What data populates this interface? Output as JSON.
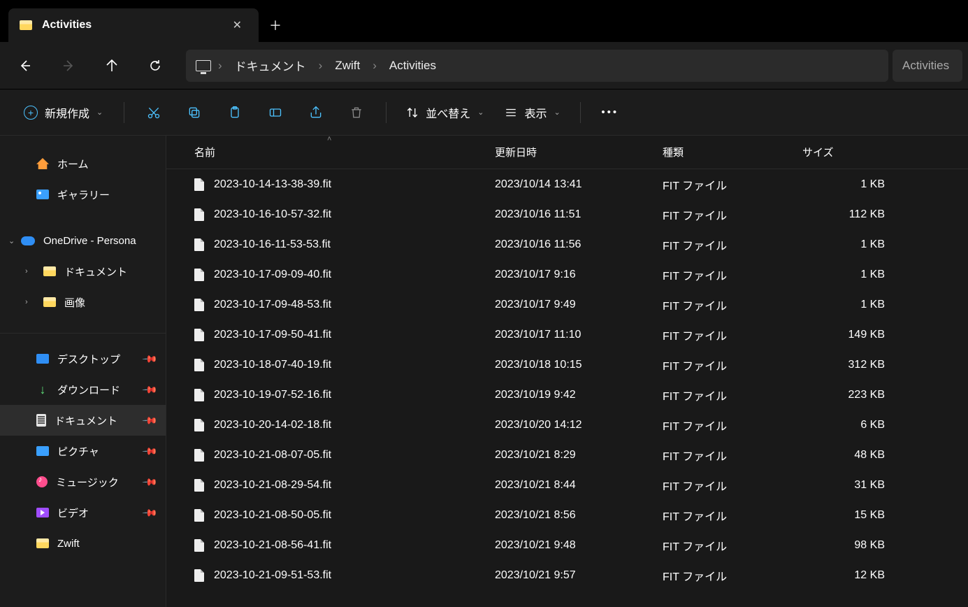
{
  "tab": {
    "title": "Activities"
  },
  "breadcrumb": {
    "items": [
      "ドキュメント",
      "Zwift",
      "Activities"
    ]
  },
  "search": {
    "placeholder": "Activities"
  },
  "toolbar": {
    "new_label": "新規作成",
    "sort_label": "並べ替え",
    "view_label": "表示"
  },
  "sidebar": {
    "home": "ホーム",
    "gallery": "ギャラリー",
    "onedrive": "OneDrive - Persona",
    "documents": "ドキュメント",
    "pictures": "画像",
    "quick": {
      "desktop": "デスクトップ",
      "downloads": "ダウンロード",
      "documents": "ドキュメント",
      "pictures_q": "ピクチャ",
      "music": "ミュージック",
      "video": "ビデオ",
      "zwift": "Zwift"
    }
  },
  "columns": {
    "name": "名前",
    "date": "更新日時",
    "type": "種類",
    "size": "サイズ"
  },
  "files": [
    {
      "name": "2023-10-14-13-38-39.fit",
      "date": "2023/10/14 13:41",
      "type": "FIT ファイル",
      "size": "1 KB"
    },
    {
      "name": "2023-10-16-10-57-32.fit",
      "date": "2023/10/16 11:51",
      "type": "FIT ファイル",
      "size": "112 KB"
    },
    {
      "name": "2023-10-16-11-53-53.fit",
      "date": "2023/10/16 11:56",
      "type": "FIT ファイル",
      "size": "1 KB"
    },
    {
      "name": "2023-10-17-09-09-40.fit",
      "date": "2023/10/17 9:16",
      "type": "FIT ファイル",
      "size": "1 KB"
    },
    {
      "name": "2023-10-17-09-48-53.fit",
      "date": "2023/10/17 9:49",
      "type": "FIT ファイル",
      "size": "1 KB"
    },
    {
      "name": "2023-10-17-09-50-41.fit",
      "date": "2023/10/17 11:10",
      "type": "FIT ファイル",
      "size": "149 KB"
    },
    {
      "name": "2023-10-18-07-40-19.fit",
      "date": "2023/10/18 10:15",
      "type": "FIT ファイル",
      "size": "312 KB"
    },
    {
      "name": "2023-10-19-07-52-16.fit",
      "date": "2023/10/19 9:42",
      "type": "FIT ファイル",
      "size": "223 KB"
    },
    {
      "name": "2023-10-20-14-02-18.fit",
      "date": "2023/10/20 14:12",
      "type": "FIT ファイル",
      "size": "6 KB"
    },
    {
      "name": "2023-10-21-08-07-05.fit",
      "date": "2023/10/21 8:29",
      "type": "FIT ファイル",
      "size": "48 KB"
    },
    {
      "name": "2023-10-21-08-29-54.fit",
      "date": "2023/10/21 8:44",
      "type": "FIT ファイル",
      "size": "31 KB"
    },
    {
      "name": "2023-10-21-08-50-05.fit",
      "date": "2023/10/21 8:56",
      "type": "FIT ファイル",
      "size": "15 KB"
    },
    {
      "name": "2023-10-21-08-56-41.fit",
      "date": "2023/10/21 9:48",
      "type": "FIT ファイル",
      "size": "98 KB"
    },
    {
      "name": "2023-10-21-09-51-53.fit",
      "date": "2023/10/21 9:57",
      "type": "FIT ファイル",
      "size": "12 KB"
    }
  ]
}
